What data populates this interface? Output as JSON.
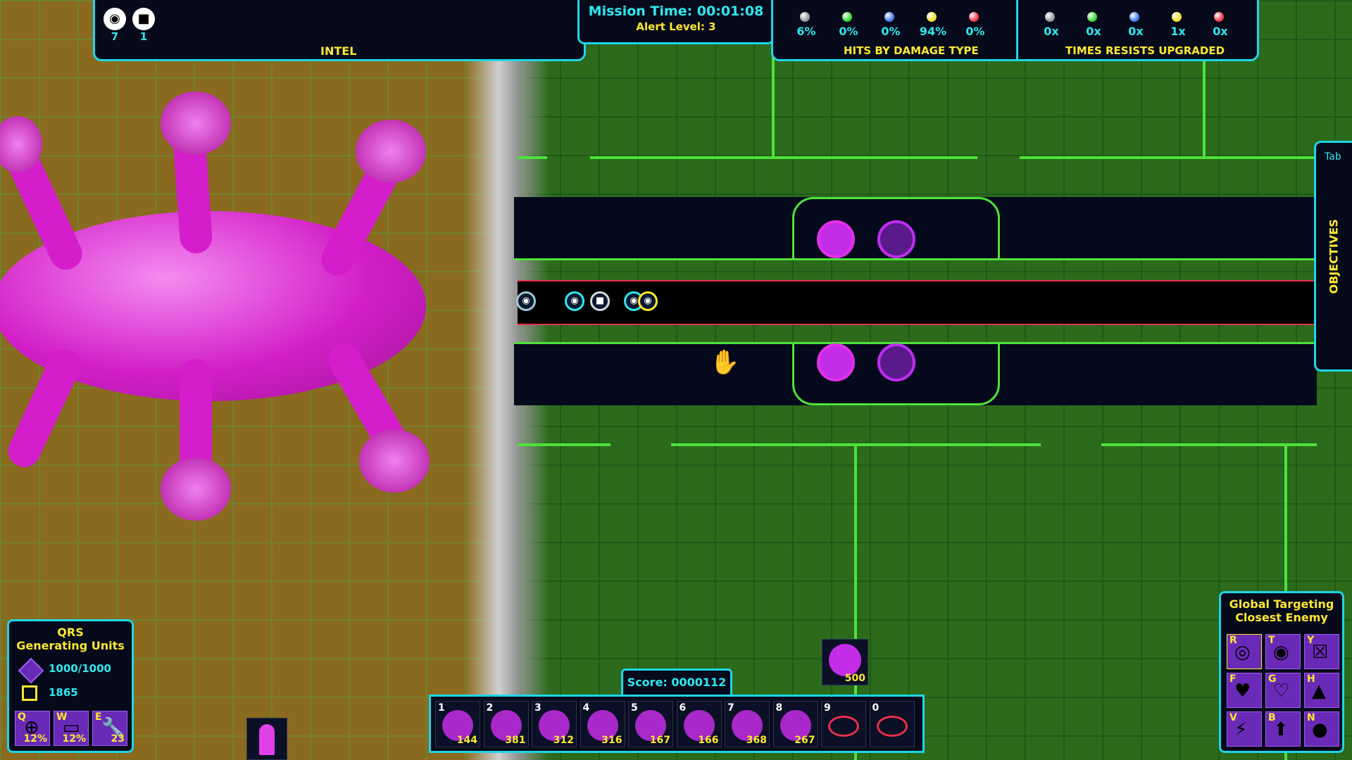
{
  "top_bar": {
    "intel_label": "INTEL",
    "intel_units": [
      {
        "icon": "helmet-unit-icon",
        "count": "7"
      },
      {
        "icon": "tank-unit-icon",
        "count": "1"
      }
    ],
    "mission_time": "Mission Time: 00:01:08",
    "alert_level": "Alert Level: 3",
    "hits_label": "HITS BY DAMAGE TYPE",
    "hits": [
      {
        "color": "#9a9a9a",
        "value": "6%"
      },
      {
        "color": "#3ad83a",
        "value": "0%"
      },
      {
        "color": "#4a7cf0",
        "value": "0%"
      },
      {
        "color": "#f0e030",
        "value": "94%"
      },
      {
        "color": "#f03a4a",
        "value": "0%"
      }
    ],
    "resists_label": "TIMES RESISTS UPGRADED",
    "resists": [
      {
        "color": "#9a9a9a",
        "value": "0x"
      },
      {
        "color": "#3ad83a",
        "value": "0x"
      },
      {
        "color": "#4a7cf0",
        "value": "0x"
      },
      {
        "color": "#f0e030",
        "value": "1x"
      },
      {
        "color": "#f03a4a",
        "value": "0x"
      }
    ]
  },
  "objectives_tab": {
    "key": "Tab",
    "label": "OBJECTIVES"
  },
  "qrs_panel": {
    "title": "QRS",
    "status": "Generating Units",
    "health": "1000/1000",
    "resources": "1865",
    "abilities": [
      {
        "key": "Q",
        "value": "12%",
        "icon": "crosshair-icon"
      },
      {
        "key": "W",
        "value": "12%",
        "icon": "shield-icon"
      },
      {
        "key": "E",
        "value": "23",
        "icon": "wrench-icon"
      }
    ]
  },
  "score": "Score: 0000112",
  "special_unit": {
    "cost": "500",
    "icon": "special-tower-icon"
  },
  "build_bar": [
    {
      "key": "1",
      "cost": "144",
      "icon": "tower-1-icon"
    },
    {
      "key": "2",
      "cost": "381",
      "icon": "tower-2-icon"
    },
    {
      "key": "3",
      "cost": "312",
      "icon": "tower-3-icon"
    },
    {
      "key": "4",
      "cost": "316",
      "icon": "tower-4-icon"
    },
    {
      "key": "5",
      "cost": "167",
      "icon": "tower-5-icon"
    },
    {
      "key": "6",
      "cost": "166",
      "icon": "tower-6-icon"
    },
    {
      "key": "7",
      "cost": "368",
      "icon": "tower-7-icon"
    },
    {
      "key": "8",
      "cost": "267",
      "icon": "tower-8-icon"
    },
    {
      "key": "9",
      "cost": "",
      "icon": "locked-slot-icon"
    },
    {
      "key": "0",
      "cost": "",
      "icon": "locked-slot-icon"
    }
  ],
  "global_targeting": {
    "title": "Global Targeting",
    "mode": "Closest Enemy",
    "buttons": [
      {
        "key": "R",
        "icon": "target-ring-icon"
      },
      {
        "key": "T",
        "icon": "target-rings-icon"
      },
      {
        "key": "Y",
        "icon": "target-box-icon"
      },
      {
        "key": "F",
        "icon": "heart-icon"
      },
      {
        "key": "G",
        "icon": "small-heart-icon"
      },
      {
        "key": "H",
        "icon": "bullet-icon"
      },
      {
        "key": "V",
        "icon": "lightning-icon"
      },
      {
        "key": "B",
        "icon": "arrow-up-icon"
      },
      {
        "key": "N",
        "icon": "globe-icon"
      }
    ]
  }
}
